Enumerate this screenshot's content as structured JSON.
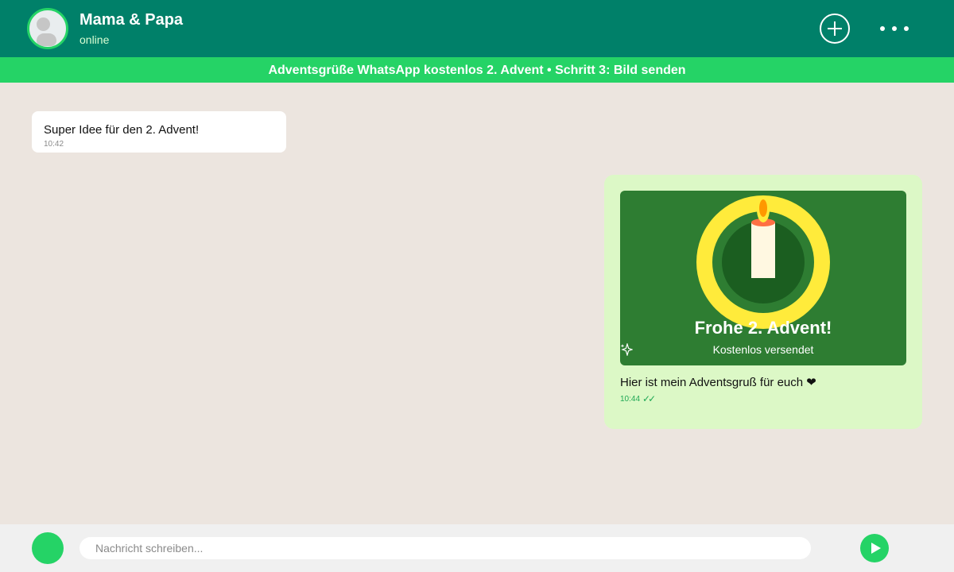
{
  "header": {
    "contact_name": "Mama & Papa",
    "status": "online",
    "avatar_icon": "person-avatar-icon",
    "add_icon": "plus-circle-icon",
    "menu_icon": "more-dots-icon"
  },
  "banner": {
    "text": "Adventsgrüße WhatsApp kostenlos 2. Advent • Schritt 3: Bild senden"
  },
  "messages": [
    {
      "direction": "incoming",
      "text": "Super Idee für den 2. Advent!",
      "time": "10:42"
    },
    {
      "direction": "outgoing",
      "image_card": {
        "title": "Frohe 2. Advent!",
        "subtitle": "Kostenlos versendet",
        "icon": "sparkle-icon"
      },
      "text": "Hier ist mein Adventsgruß für euch ❤",
      "time": "10:44",
      "status_icon": "double-check-icon",
      "status_glyph": "✓✓"
    }
  ],
  "composer": {
    "placeholder": "Nachricht schreiben...",
    "value": "",
    "emoji_button_icon": "emoji-icon",
    "send_icon": "send-icon"
  },
  "colors": {
    "header": "#008069",
    "accent": "#25d366",
    "chat_background": "#ece5df",
    "outgoing_bubble": "#dcf8c6",
    "card_background": "#2e7d32",
    "wreath": "#ffeb3b",
    "candle": "#fff8e1",
    "flame": "#ff9800"
  }
}
